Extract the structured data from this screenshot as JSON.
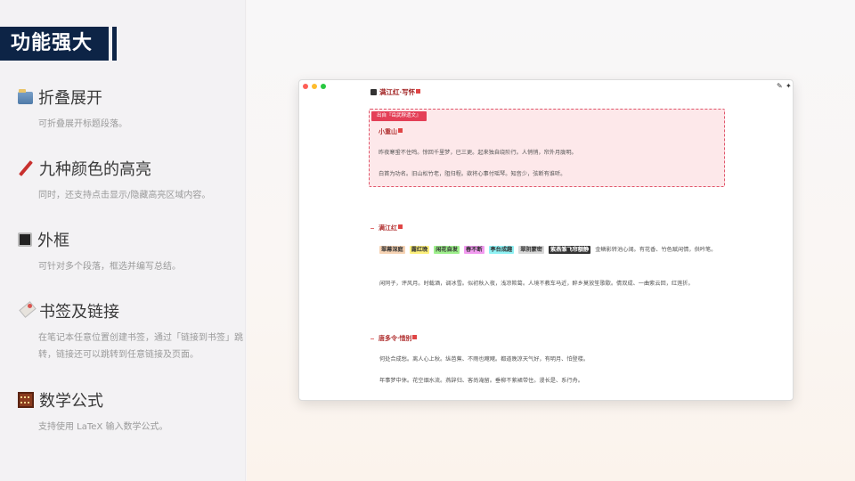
{
  "title": "功能强大",
  "features": [
    {
      "icon": "folder-icon",
      "title": "折叠展开",
      "desc": "可折叠展开标题段落。"
    },
    {
      "icon": "pen-icon",
      "title": "九种颜色的高亮",
      "desc": "同时，还支持点击显示/隐藏高亮区域内容。"
    },
    {
      "icon": "frame-icon",
      "title": "外框",
      "desc": "可针对多个段落，框选并编写总结。"
    },
    {
      "icon": "bookmark-icon",
      "title": "书签及链接",
      "desc": "在笔记本任意位置创建书签，通过「链接到书签」跳转，链接还可以跳转到任意链接及页面。"
    },
    {
      "icon": "abacus-icon",
      "title": "数学公式",
      "desc": "支持使用 LaTeX 输入数学公式。"
    }
  ],
  "doc": {
    "title": "满江红·写怀",
    "frame_label": "出自『岳武穆遗文』",
    "section1_title": "小重山",
    "section1_p1": "昨夜寒蛩不住鸣。惊回千里梦，已三更。起来独自绕阶行。人悄悄，帘外月胧明。",
    "section1_p2": "白首为功名。旧山松竹老，阻归程。欲将心事付瑶琴。知音少，弦断有谁听。",
    "section2_title": "满江红",
    "highlights": [
      {
        "text": "翠幕深庭",
        "color": "#f6d3b4"
      },
      {
        "text": "露红晚",
        "color": "#fdf07c"
      },
      {
        "text": "闲花自发",
        "color": "#9ef08c"
      },
      {
        "text": "春不断",
        "color": "#f29bf0"
      },
      {
        "text": "亭台成趣",
        "color": "#8ff2f4"
      },
      {
        "text": "翠阴蒙密",
        "color": "#d8d8d8"
      },
      {
        "text": "紫燕雏飞帘额静",
        "color": "#333333"
      }
    ],
    "highlight_tail": "金鳞影转池心阔。有花香、竹色赋闲情，供吟笔。",
    "section2_p2": "闲同子，评风月。时载酒，调冰雪。似初秋入夜，浅凉欺葛。人境不教车马近，醉乡莫放笙歌歇。倩双成、一曲紫云回，红莲折。",
    "section3_title": "唐多令·惜别",
    "section3_p1": "何处合成愁。离人心上秋。纵芭蕉、不雨也飕飕。都道晚凉天气好，有明月、怕登楼。",
    "section3_p2": "年事梦中休。花空烟水流。燕辞归、客尚淹留。垂柳不萦裙带住。漫长是、系行舟。"
  }
}
